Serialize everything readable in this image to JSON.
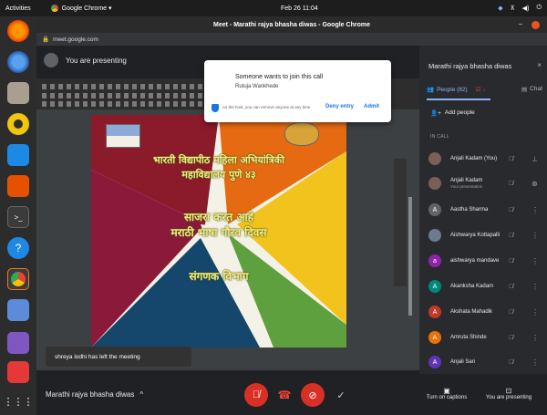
{
  "system": {
    "activities": "Activities",
    "app_menu": "Google Chrome ▾",
    "clock": "Feb 26  11:04",
    "tray": [
      "◆",
      "⊼",
      "◀)",
      "⏻"
    ]
  },
  "browser": {
    "window_title": "Meet - Marathi rajya bhasha diwas - Google Chrome",
    "url": "meet.google.com"
  },
  "presenting": {
    "label": "You are presenting"
  },
  "slide": {
    "line1": "भारती विद्यापीठ महिला अभियांत्रिकी",
    "line2": "महाविद्यालय पुणे ४३",
    "line3": "साजरा करत आहे",
    "line4": "मराठी भाषा गौरव दिवस",
    "line5": "संगणक विभाग"
  },
  "notification": {
    "title": "Someone wants to join this call",
    "person": "Rutuja Wankhede",
    "host_note": "As the host, you can remove anyone at any time",
    "deny": "Deny entry",
    "admit": "Admit"
  },
  "toast": {
    "message": "shreya lodhi has left the meeting"
  },
  "meeting": {
    "name": "Marathi rajya bhasha diwas",
    "chevron": "^"
  },
  "panel": {
    "title": "Marathi rajya bhasha diwas",
    "close": "×",
    "people_tab": "People (82)",
    "chat_tab": "Chat",
    "add_people": "Add people",
    "in_call": "IN CALL",
    "participants": [
      {
        "name": "Anjali Kadam (You)",
        "sub": "",
        "color": "#7b5e57",
        "initial": "",
        "mic": "🎙",
        "more": "⋮"
      },
      {
        "name": "Anjali Kadam",
        "sub": "Your presentation",
        "color": "#7b5e57",
        "initial": "",
        "mic": "🎙",
        "more": "⋮"
      },
      {
        "name": "Aastha Sharma",
        "sub": "",
        "color": "#5f6368",
        "initial": "A",
        "mic": "🎙",
        "more": "⋮"
      },
      {
        "name": "Aishwarya Kottapalli",
        "sub": "",
        "color": "#6d7b8d",
        "initial": "",
        "mic": "🎙",
        "more": "⋮"
      },
      {
        "name": "aishwarya mandave",
        "sub": "",
        "color": "#8e24aa",
        "initial": "a",
        "mic": "🎙",
        "more": "⋮"
      },
      {
        "name": "Akanksha Kadam",
        "sub": "",
        "color": "#00897b",
        "initial": "A",
        "mic": "🎙",
        "more": "⋮"
      },
      {
        "name": "Akshata Mahadik",
        "sub": "",
        "color": "#c0392b",
        "initial": "A",
        "mic": "🎙",
        "more": "⋮"
      },
      {
        "name": "Amruta Shinde",
        "sub": "",
        "color": "#e8710a",
        "initial": "A",
        "mic": "🎙",
        "more": "⋮"
      },
      {
        "name": "Anjali Sari",
        "sub": "",
        "color": "#5e35b1",
        "initial": "A",
        "mic": "🎙",
        "more": "⋮"
      }
    ]
  },
  "footer": {
    "captions": "Turn on captions",
    "presenting": "You are presenting"
  },
  "colors": {
    "accent": "#8ab4f8",
    "danger": "#ea4335",
    "link": "#1a73e8"
  }
}
